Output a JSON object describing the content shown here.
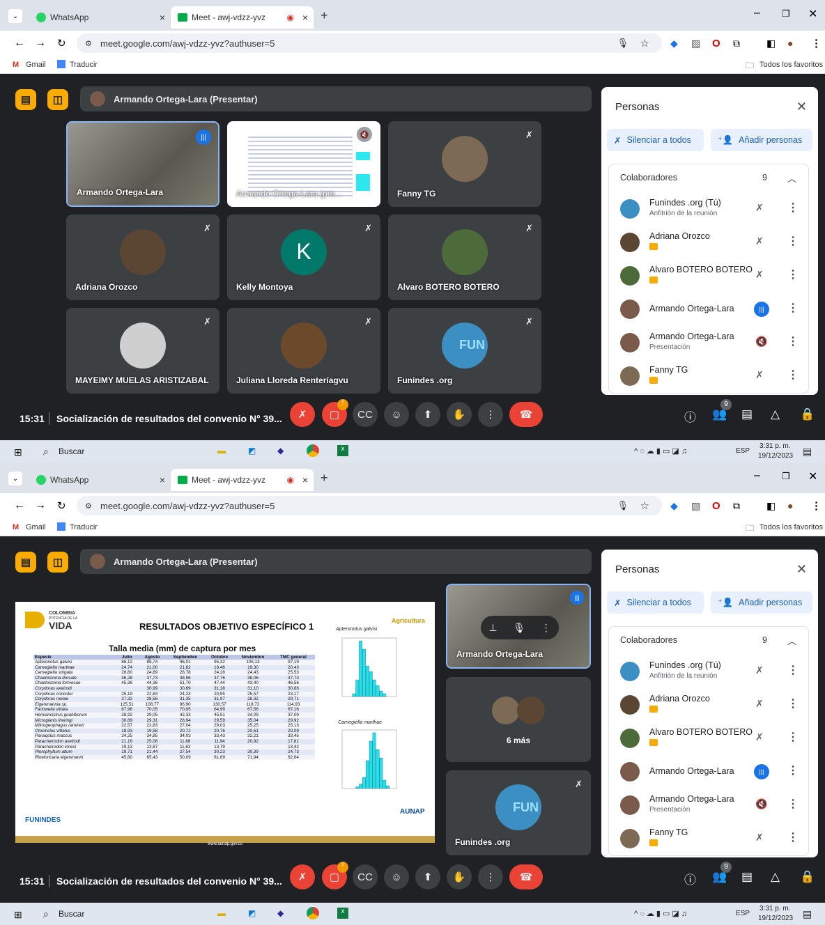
{
  "browser": {
    "tabs": [
      {
        "label": "WhatsApp",
        "close": "×"
      },
      {
        "label": "Meet - awj-vdzz-yvz",
        "close": "×",
        "status": "◉"
      }
    ],
    "new_tab": "+",
    "url": "meet.google.com/awj-vdzz-yvz?authuser=5",
    "bookmarks": [
      "Gmail",
      "Traducir"
    ],
    "all_favorites": "Todos los favoritos"
  },
  "meeting": {
    "presenter_bar": "Armando Ortega-Lara (Presentar)",
    "time": "15:31",
    "title": "Socialización de resultados del convenio N° 39...",
    "participants_count": "9",
    "controls": [
      "mic-off",
      "camera-off",
      "captions",
      "emoji",
      "present",
      "hand",
      "more",
      "leave"
    ],
    "tiles": [
      {
        "name": "Armando Ortega-Lara",
        "kind": "camera",
        "speaking": true
      },
      {
        "name": "Armando Ortega-Lara (pre...",
        "kind": "slide"
      },
      {
        "name": "Fanny TG",
        "kind": "avatar",
        "color": "#7c6a55"
      },
      {
        "name": "Adriana Orozco",
        "kind": "avatar",
        "color": "#5b4634"
      },
      {
        "name": "Kelly Montoya",
        "kind": "letter",
        "letter": "K",
        "color": "#00796b"
      },
      {
        "name": "Alvaro BOTERO BOTERO",
        "kind": "avatar",
        "color": "#4d6b3a"
      },
      {
        "name": "MAYEIMY MUELAS ARISTIZABAL",
        "kind": "avatar",
        "color": "#cfcfcf"
      },
      {
        "name": "Juliana Lloreda Renteríagvu",
        "kind": "avatar",
        "color": "#6a4a2a"
      },
      {
        "name": "Funindes .org",
        "kind": "logo",
        "logo_text": "FUN",
        "color": "#3b8fc2"
      }
    ],
    "side_tiles": [
      {
        "name": "Armando Ortega-Lara",
        "kind": "camera"
      },
      {
        "name": "6 más",
        "kind": "more"
      },
      {
        "name": "Funindes .org",
        "kind": "logo",
        "logo_text": "FUN"
      }
    ]
  },
  "people_panel": {
    "title": "Personas",
    "mute_all": "Silenciar a todos",
    "add_people": "Añadir personas",
    "section": "Colaboradores",
    "count": "9",
    "people": [
      {
        "name": "Funindes .org (Tú)",
        "sub": "Anfitrión de la reunión",
        "color": "#3b8fc2",
        "badge": false
      },
      {
        "name": "Adriana Orozco",
        "sub": "",
        "color": "#5b4634",
        "badge": true
      },
      {
        "name": "Alvaro BOTERO BOTERO",
        "sub": "",
        "color": "#4d6b3a",
        "badge": true
      },
      {
        "name": "Armando Ortega-Lara",
        "sub": "",
        "color": "#7a5a4a",
        "badge": false,
        "speaking": true
      },
      {
        "name": "Armando Ortega-Lara",
        "sub": "Presentación",
        "color": "#7a5a4a",
        "badge": false
      },
      {
        "name": "Fanny TG",
        "sub": "",
        "color": "#7c6a55",
        "badge": true
      }
    ]
  },
  "slide": {
    "brand_top": "COLOMBIA",
    "brand_small": "POTENCIA DE LA",
    "brand": "VIDA",
    "agri": "Agricultura",
    "heading": "RESULTADOS OBJETIVO ESPECÍFICO 1",
    "subheading": "Talla media (mm) de captura por mes",
    "chart1_title": "Apteronotus galvisi",
    "chart2_title": "Carnegiella marthae",
    "footer_left": "FUNINDES",
    "footer_right": "AUNAP",
    "footer_url": "www.aunap.gov.co",
    "columns": [
      "Especie",
      "Julio",
      "Agosto",
      "Septiembre",
      "Octubre",
      "Noviembre",
      "TMC general"
    ],
    "rows": [
      [
        "Apteronotus galvisi",
        "86,12",
        "89,74",
        "96,01",
        "95,32",
        "105,13",
        "97,19"
      ],
      [
        "Carnegiella marthae",
        "24,74",
        "21,00",
        "21,82",
        "19,46",
        "19,30",
        "20,43"
      ],
      [
        "Carnegiella strigata",
        "26,80",
        "24,89",
        "28,78",
        "24,28",
        "24,43",
        "25,53"
      ],
      [
        "Chaetostoma dorsale",
        "36,28",
        "37,73",
        "38,96",
        "37,76",
        "38,06",
        "37,73"
      ],
      [
        "Chaetostoma formosae",
        "45,36",
        "44,36",
        "51,70",
        "47,44",
        "43,40",
        "46,56"
      ],
      [
        "Corydoras axelrodi",
        "",
        "30,99",
        "30,69",
        "31,28",
        "31,10",
        "30,88"
      ],
      [
        "Corydoras concolor",
        "25,19",
        "22,84",
        "24,23",
        "20,55",
        "25,57",
        "23,17"
      ],
      [
        "Corydoras metae",
        "27,32",
        "28,56",
        "31,35",
        "31,97",
        "28,32",
        "29,71"
      ],
      [
        "Eigenmannia sp.",
        "125,51",
        "108,77",
        "96,90",
        "130,57",
        "118,72",
        "114,93"
      ],
      [
        "Farlowella vittata",
        "87,96",
        "70,05",
        "70,05",
        "64,99",
        "67,58",
        "67,16"
      ],
      [
        "Hemiancistrus guahiborum",
        "28,92",
        "29,05",
        "42,33",
        "45,51",
        "34,09",
        "37,09"
      ],
      [
        "Microglanis iheringi",
        "30,89",
        "29,31",
        "28,94",
        "29,59",
        "35,04",
        "29,92"
      ],
      [
        "Mikrogeophagus ramirezi",
        "22,57",
        "22,83",
        "27,04",
        "29,03",
        "25,25",
        "25,13"
      ],
      [
        "Otocinclus vittatus",
        "18,93",
        "19,58",
        "20,72",
        "20,76",
        "20,61",
        "20,09"
      ],
      [
        "Panaqolus maccus",
        "34,25",
        "34,85",
        "34,03",
        "33,43",
        "32,21",
        "33,45"
      ],
      [
        "Paracheirodon axelrodi",
        "21,16",
        "25,08",
        "11,88",
        "11,94",
        "20,92",
        "17,81"
      ],
      [
        "Paracheirodon innesi",
        "19,13",
        "13,87",
        "11,63",
        "13,79",
        "",
        "13,42"
      ],
      [
        "Pterophyllum altum",
        "19,71",
        "21,44",
        "27,54",
        "30,23",
        "30,39",
        "24,73"
      ],
      [
        "Rineloricaria eigenmanni",
        "45,80",
        "65,43",
        "50,09",
        "61,69",
        "71,94",
        "62,64"
      ]
    ]
  },
  "taskbar": {
    "search": "Buscar",
    "time": "3:31 p. m.",
    "date": "19/12/2023",
    "lang": "ESP"
  }
}
